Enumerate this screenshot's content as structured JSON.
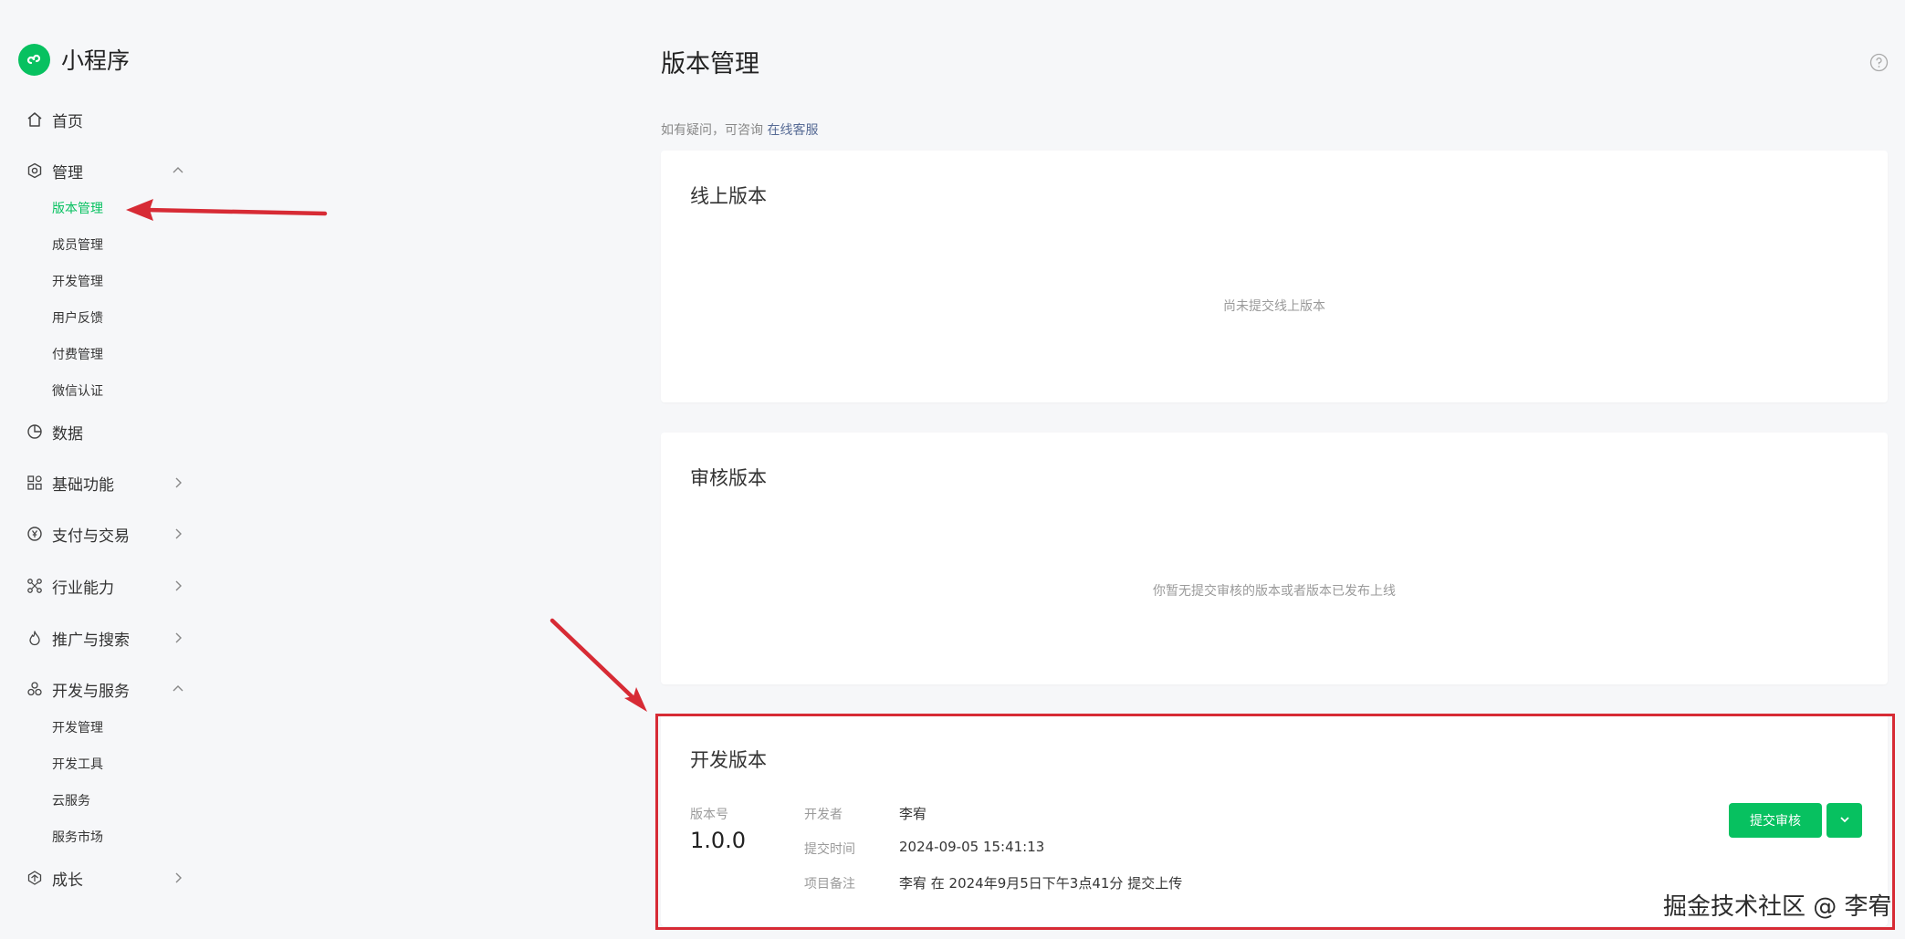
{
  "brand": {
    "name": "小程序",
    "accent": "#07c160"
  },
  "sidebar": {
    "home": "首页",
    "manage": {
      "label": "管理",
      "items": [
        "版本管理",
        "成员管理",
        "开发管理",
        "用户反馈",
        "付费管理",
        "微信认证"
      ]
    },
    "data": "数据",
    "basic": "基础功能",
    "pay": "支付与交易",
    "industry": "行业能力",
    "promo": "推广与搜索",
    "devservice": {
      "label": "开发与服务",
      "items": [
        "开发管理",
        "开发工具",
        "云服务",
        "服务市场"
      ]
    },
    "growth": "成长"
  },
  "main": {
    "title": "版本管理",
    "hint_prefix": "如有疑问，可咨询",
    "hint_link": "在线客服",
    "online": {
      "title": "线上版本",
      "empty": "尚未提交线上版本"
    },
    "review": {
      "title": "审核版本",
      "empty": "你暂无提交审核的版本或者版本已发布上线"
    },
    "dev": {
      "title": "开发版本",
      "version_label": "版本号",
      "version": "1.0.0",
      "developer_label": "开发者",
      "developer": "李宥",
      "time_label": "提交时间",
      "time": "2024-09-05 15:41:13",
      "note_label": "项目备注",
      "note": "李宥 在 2024年9月5日下午3点41分 提交上传",
      "submit_button": "提交审核"
    }
  },
  "watermark": "掘金技术社区 @ 李宥",
  "colors": {
    "accent": "#07c160",
    "annotation": "#d72b35",
    "link": "#576b95"
  }
}
